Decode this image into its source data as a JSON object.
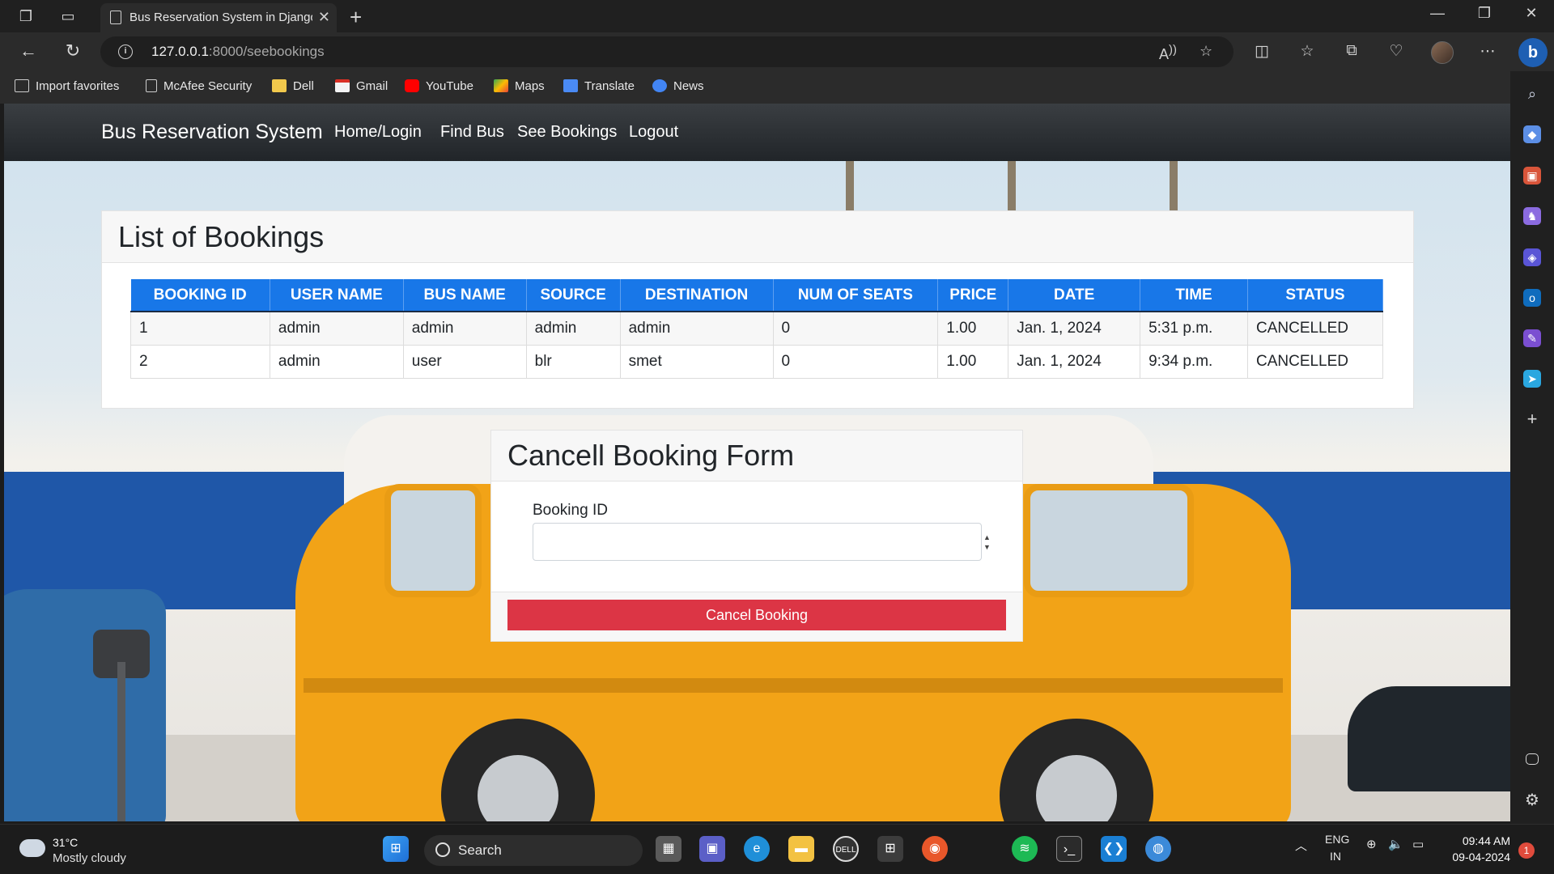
{
  "browser": {
    "tab_title": "Bus Reservation System in Django",
    "url_host": "127.0.0.1",
    "url_path": ":8000/seebookings",
    "favorites": [
      {
        "label": "Import favorites",
        "icon": "import-icon"
      },
      {
        "label": "McAfee Security",
        "icon": "page-icon"
      },
      {
        "label": "Dell",
        "icon": "folder-icon"
      },
      {
        "label": "Gmail",
        "icon": "gmail-icon"
      },
      {
        "label": "YouTube",
        "icon": "youtube-icon"
      },
      {
        "label": "Maps",
        "icon": "maps-icon"
      },
      {
        "label": "Translate",
        "icon": "translate-icon"
      },
      {
        "label": "News",
        "icon": "news-icon"
      }
    ]
  },
  "site": {
    "brand": "Bus Reservation System",
    "nav": [
      "Home/Login",
      "Find Bus",
      "See Bookings",
      "Logout"
    ]
  },
  "bookings": {
    "title": "List of Bookings",
    "columns": [
      "BOOKING ID",
      "USER NAME",
      "BUS NAME",
      "SOURCE",
      "DESTINATION",
      "NUM OF SEATS",
      "PRICE",
      "DATE",
      "TIME",
      "STATUS"
    ],
    "rows": [
      [
        "1",
        "admin",
        "admin",
        "admin",
        "admin",
        "0",
        "1.00",
        "Jan. 1, 2024",
        "5:31 p.m.",
        "CANCELLED"
      ],
      [
        "2",
        "admin",
        "user",
        "blr",
        "smet",
        "0",
        "1.00",
        "Jan. 1, 2024",
        "9:34 p.m.",
        "CANCELLED"
      ]
    ],
    "header_color": "#1877e8"
  },
  "cancel_form": {
    "title": "Cancell Booking Form",
    "field_label": "Booking ID",
    "field_value": "",
    "button_label": "Cancel Booking",
    "button_color": "#dc3545"
  },
  "taskbar": {
    "weather_temp": "31°C",
    "weather_desc": "Mostly cloudy",
    "search_label": "Search",
    "lang_top": "ENG",
    "lang_bottom": "IN",
    "time": "09:44 AM",
    "date": "09-04-2024",
    "notification_count": "1"
  }
}
